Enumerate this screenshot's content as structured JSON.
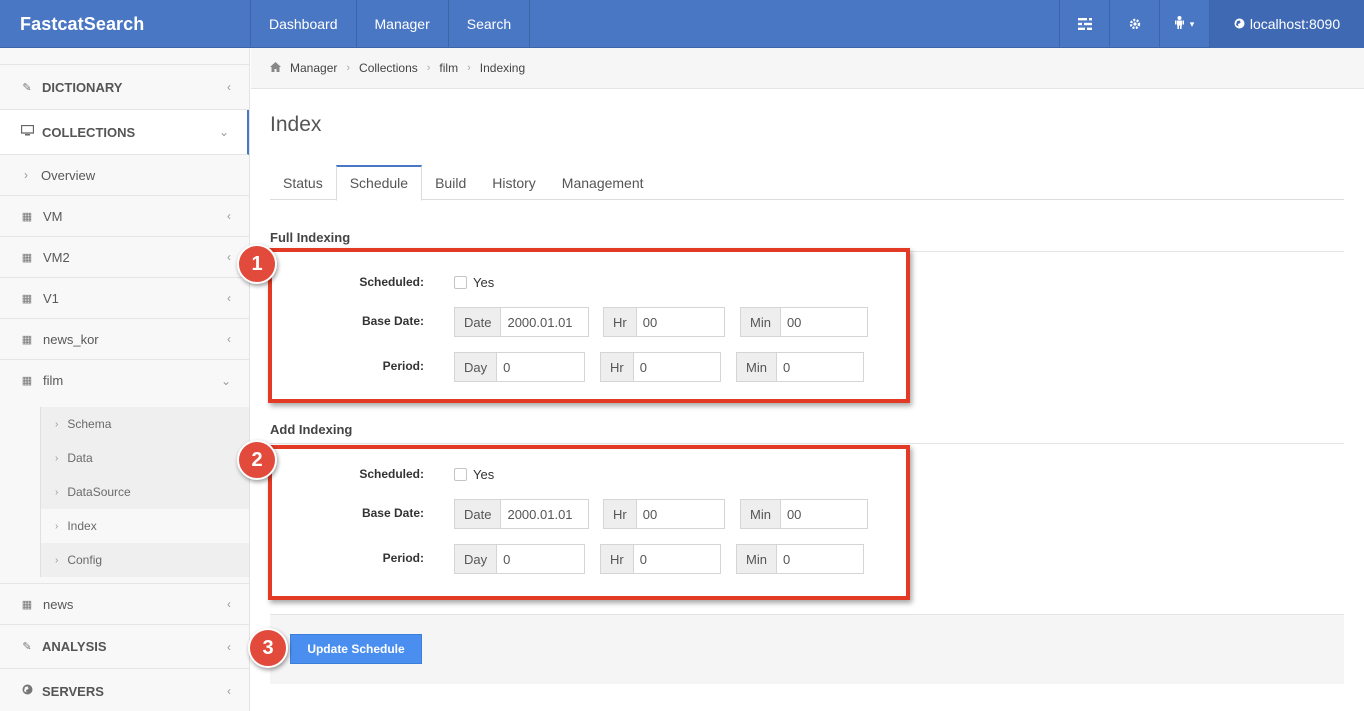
{
  "app": {
    "brand": "FastcatSearch"
  },
  "navbar": {
    "links": [
      "Dashboard",
      "Manager",
      "Search"
    ],
    "icons": [
      "tasks-icon",
      "gear-icon",
      "user-icon"
    ],
    "user_caret": "▾",
    "host": "localhost:8090"
  },
  "sidebar": {
    "dictionary": "DICTIONARY",
    "collections": "COLLECTIONS",
    "overview": "Overview",
    "items": [
      "VM",
      "VM2",
      "V1",
      "news_kor",
      "film"
    ],
    "film_children": [
      "Schema",
      "Data",
      "DataSource",
      "Index",
      "Config"
    ],
    "news": "news",
    "analysis": "ANALYSIS",
    "servers": "SERVERS"
  },
  "breadcrumb": [
    "Manager",
    "Collections",
    "film",
    "Indexing"
  ],
  "page": {
    "title": "Index"
  },
  "tabs": [
    "Status",
    "Schedule",
    "Build",
    "History",
    "Management"
  ],
  "active_tab": "Schedule",
  "full_indexing": {
    "title": "Full Indexing",
    "scheduled_label": "Scheduled:",
    "scheduled_option": "Yes",
    "base_date_label": "Base Date:",
    "date_addon": "Date",
    "date_value": "2000.01.01",
    "hr_addon": "Hr",
    "hr_value": "00",
    "min_addon": "Min",
    "min_value": "00",
    "period_label": "Period:",
    "day_addon": "Day",
    "day_value": "0",
    "period_hr_addon": "Hr",
    "period_hr_value": "0",
    "period_min_addon": "Min",
    "period_min_value": "0"
  },
  "add_indexing": {
    "title": "Add Indexing",
    "scheduled_label": "Scheduled:",
    "scheduled_option": "Yes",
    "base_date_label": "Base Date:",
    "date_addon": "Date",
    "date_value": "2000.01.01",
    "hr_addon": "Hr",
    "hr_value": "00",
    "min_addon": "Min",
    "min_value": "00",
    "period_label": "Period:",
    "day_addon": "Day",
    "day_value": "0",
    "period_hr_addon": "Hr",
    "period_hr_value": "0",
    "period_min_addon": "Min",
    "period_min_value": "0"
  },
  "update_button": "Update Schedule",
  "annotations": [
    "1",
    "2",
    "3"
  ],
  "colors": {
    "navbar": "#4a77c4",
    "highlight": "#e23a24",
    "badge": "#e24a3b",
    "primary_button": "#4a8ef0"
  }
}
